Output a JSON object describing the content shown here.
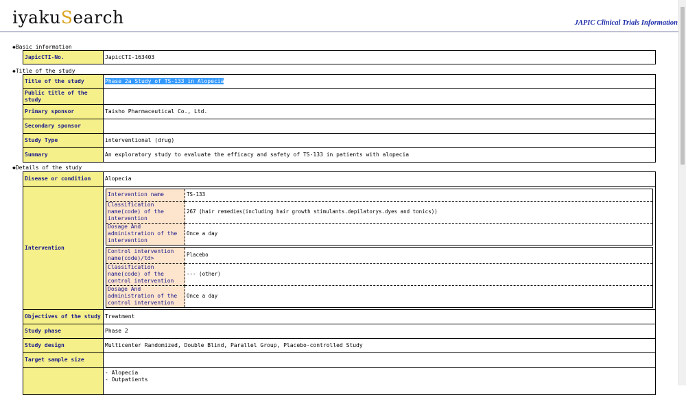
{
  "logo": {
    "part1": "iyaku",
    "part2": "S",
    "part3": "earch"
  },
  "site_title": "JAPIC Clinical Trials Information",
  "sections": {
    "basic": "◆Basic information",
    "title": "◆Title of the study",
    "details": "◆Details of the study"
  },
  "basic": {
    "cti_label": "JapicCTI-No.",
    "cti_value": "JapicCTI-163403"
  },
  "title_rows": {
    "title_label": "Title of the study",
    "title_value": "Phase 2a Study of TS-133 in Alopecia",
    "public_label": "Public title of the study",
    "public_value": "",
    "primary_label": "Primary sponsor",
    "primary_value": "Taisho Pharmaceutical Co., Ltd.",
    "secondary_label": "Secondary sponsor",
    "secondary_value": "",
    "type_label": "Study Type",
    "type_value": "interventional (drug)",
    "summary_label": "Summary",
    "summary_value": "An exploratory study to evaluate the efficacy and safety of TS-133 in patients with alopecia"
  },
  "details": {
    "disease_label": "Disease or condition",
    "disease_value": "Alopecia",
    "intervention_label": "Intervention",
    "intervention": {
      "name_label": "Intervention name",
      "name_value": "TS-133",
      "class_label": "Classification name(code) of the intervention",
      "class_value": "267 (hair remedies(including hair growth stimulants.depilatorys.dyes and tonics))",
      "dosage_label": "Dosage And administration of the intervention",
      "dosage_value": "Once a day"
    },
    "control": {
      "name_label": "Control intervention name(code)/td>",
      "name_value": "Placebo",
      "class_label": "Classification name(code) of the control intervention",
      "class_value": "--- (other)",
      "dosage_label": "Dosage And administration of the control intervention",
      "dosage_value": "Once a day"
    },
    "objectives_label": "Objectives of the study",
    "objectives_value": "Treatment",
    "phase_label": "Study phase",
    "phase_value": "Phase 2",
    "design_label": "Study design",
    "design_value": "Multicenter Randomized, Double Blind, Parallel Group, Placebo-controlled Study",
    "sample_label": "Target sample size",
    "sample_value": "",
    "criteria_label": "",
    "criteria_lines": [
      "- Alopecia",
      "- Outpatients"
    ]
  }
}
